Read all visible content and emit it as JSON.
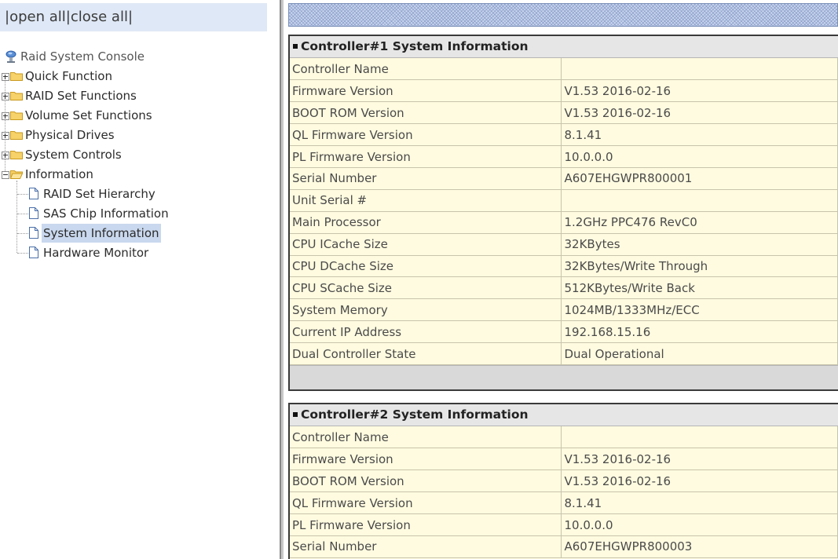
{
  "nav": {
    "open_all": "open all",
    "close_all": "close all",
    "root": "Raid System Console",
    "folders": [
      {
        "label": "Quick Function",
        "expanded": false
      },
      {
        "label": "RAID Set Functions",
        "expanded": false
      },
      {
        "label": "Volume Set Functions",
        "expanded": false
      },
      {
        "label": "Physical Drives",
        "expanded": false
      },
      {
        "label": "System Controls",
        "expanded": false
      },
      {
        "label": "Information",
        "expanded": true
      }
    ],
    "info_items": [
      {
        "label": "RAID Set Hierarchy",
        "selected": false
      },
      {
        "label": "SAS Chip Information",
        "selected": false
      },
      {
        "label": "System Information",
        "selected": true
      },
      {
        "label": "Hardware Monitor",
        "selected": false
      }
    ]
  },
  "controller1": {
    "title": "Controller#1 System Information",
    "rows": [
      {
        "k": "Controller Name",
        "v": ""
      },
      {
        "k": "Firmware Version",
        "v": "V1.53 2016-02-16"
      },
      {
        "k": "BOOT ROM Version",
        "v": "V1.53 2016-02-16"
      },
      {
        "k": "QL Firmware Version",
        "v": "8.1.41"
      },
      {
        "k": "PL Firmware Version",
        "v": "10.0.0.0"
      },
      {
        "k": "Serial Number",
        "v": "A607EHGWPR800001"
      },
      {
        "k": "Unit Serial #",
        "v": ""
      },
      {
        "k": "Main Processor",
        "v": "1.2GHz PPC476 RevC0"
      },
      {
        "k": "CPU ICache Size",
        "v": "32KBytes"
      },
      {
        "k": "CPU DCache Size",
        "v": "32KBytes/Write Through"
      },
      {
        "k": "CPU SCache Size",
        "v": "512KBytes/Write Back"
      },
      {
        "k": "System Memory",
        "v": "1024MB/1333MHz/ECC"
      },
      {
        "k": "Current IP Address",
        "v": "192.168.15.16"
      },
      {
        "k": "Dual Controller State",
        "v": "Dual Operational"
      }
    ]
  },
  "controller2": {
    "title": "Controller#2 System Information",
    "rows": [
      {
        "k": "Controller Name",
        "v": ""
      },
      {
        "k": "Firmware Version",
        "v": "V1.53 2016-02-16"
      },
      {
        "k": "BOOT ROM Version",
        "v": "V1.53 2016-02-16"
      },
      {
        "k": "QL Firmware Version",
        "v": "8.1.41"
      },
      {
        "k": "PL Firmware Version",
        "v": "10.0.0.0"
      },
      {
        "k": "Serial Number",
        "v": "A607EHGWPR800003"
      }
    ]
  },
  "colors": {
    "nav_header_bg": "#dfe8f6",
    "selected_bg": "#c9d8ee",
    "table_bg": "#fffbe0",
    "header_bg": "#e6e6e6",
    "folder": "#f5c842"
  }
}
